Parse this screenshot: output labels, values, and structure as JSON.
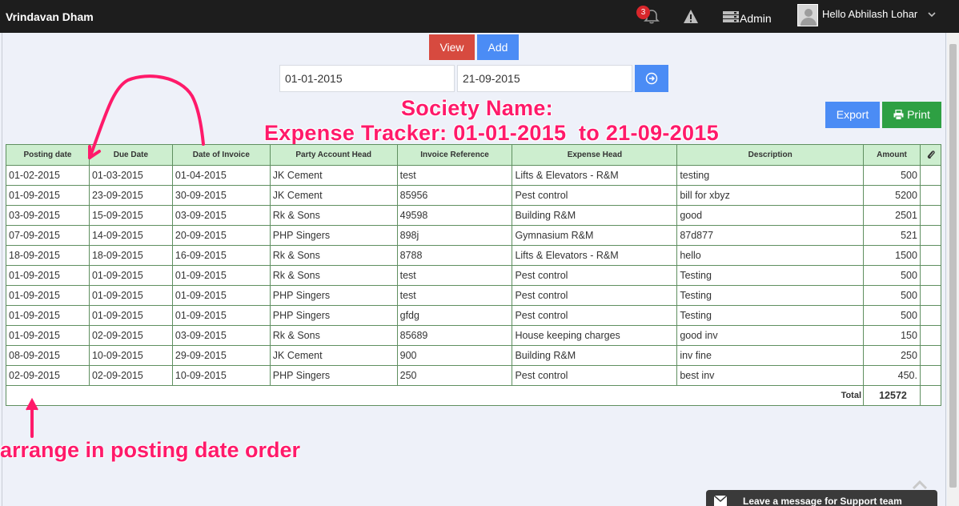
{
  "topbar": {
    "brand": "Vrindavan Dham",
    "notification_count": "3",
    "admin_label": "Admin",
    "user_greeting": "Hello Abhilash Lohar",
    "icons": [
      "bell-icon",
      "warning-icon",
      "server-icon",
      "avatar",
      "caret-down-icon"
    ]
  },
  "toolbar": {
    "view_label": "View",
    "add_label": "Add",
    "from_date": "01-01-2015",
    "to_date": "21-09-2015",
    "export_label": "Export",
    "print_label": "Print"
  },
  "report": {
    "title_line1": "Society Name:",
    "title_line2": "Expense Tracker: 01-01-2015  to 21-09-2015"
  },
  "table": {
    "headers": [
      "Posting date",
      "Due Date",
      "Date of Invoice",
      "Party Account Head",
      "Invoice Reference",
      "Expense Head",
      "Description",
      "Amount"
    ],
    "rows": [
      [
        "01-02-2015",
        "01-03-2015",
        "01-04-2015",
        "JK Cement",
        "test",
        "Lifts & Elevators - R&M",
        "testing",
        "500"
      ],
      [
        "01-09-2015",
        "23-09-2015",
        "30-09-2015",
        "JK Cement",
        "85956",
        "Pest control",
        "bill for xbyz",
        "5200"
      ],
      [
        "03-09-2015",
        "15-09-2015",
        "03-09-2015",
        "Rk & Sons",
        "49598",
        "Building R&M",
        "good",
        "2501"
      ],
      [
        "07-09-2015",
        "14-09-2015",
        "20-09-2015",
        "PHP Singers",
        "898j",
        "Gymnasium R&M",
        "87d877",
        "521"
      ],
      [
        "18-09-2015",
        "18-09-2015",
        "16-09-2015",
        "Rk & Sons",
        "8788",
        "Lifts & Elevators - R&M",
        "hello",
        "1500"
      ],
      [
        "01-09-2015",
        "01-09-2015",
        "01-09-2015",
        "Rk & Sons",
        "test",
        "Pest control",
        "Testing",
        "500"
      ],
      [
        "01-09-2015",
        "01-09-2015",
        "01-09-2015",
        "PHP Singers",
        "test",
        "Pest control",
        "Testing",
        "500"
      ],
      [
        "01-09-2015",
        "01-09-2015",
        "01-09-2015",
        "PHP Singers",
        "gfdg",
        "Pest control",
        "Testing",
        "500"
      ],
      [
        "01-09-2015",
        "02-09-2015",
        "03-09-2015",
        "Rk & Sons",
        "85689",
        "House keeping charges",
        "good inv",
        "150"
      ],
      [
        "08-09-2015",
        "10-09-2015",
        "29-09-2015",
        "JK Cement",
        "900",
        "Building R&M",
        "inv fine",
        "250"
      ],
      [
        "02-09-2015",
        "02-09-2015",
        "10-09-2015",
        "PHP Singers",
        "250",
        "Pest control",
        "best inv",
        "450."
      ]
    ],
    "total_label": "Total",
    "total_value": "12572"
  },
  "annotation": {
    "note": "arrange in posting date order"
  },
  "support": {
    "label": "Leave a message for Support team"
  },
  "colors": {
    "topbar": "#1d1d1d",
    "view_button": "#d74a3f",
    "primary_button": "#4b8cf5",
    "print_button": "#2ea043",
    "header_fill": "#cdeecf",
    "annotation": "#ff1a6a"
  }
}
